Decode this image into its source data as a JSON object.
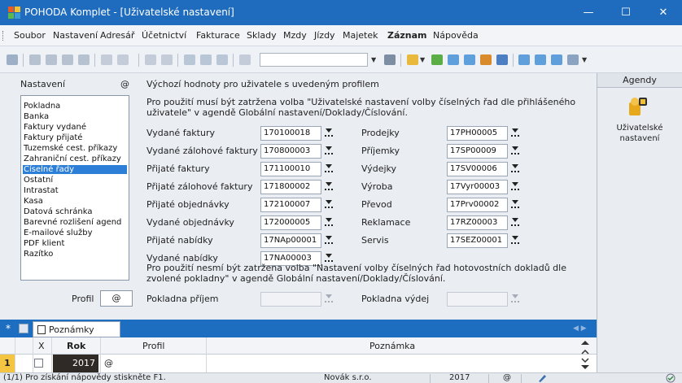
{
  "window": {
    "title": "POHODA Komplet - [Uživatelské nastavení]",
    "min_glyph": "—",
    "max_glyph": "☐",
    "close_glyph": "✕"
  },
  "menu": {
    "items": [
      "Soubor",
      "Nastavení",
      "Adresář",
      "Účetnictví",
      "Fakturace",
      "Sklady",
      "Mzdy",
      "Jízdy",
      "Majetek",
      "Záznam",
      "Nápověda"
    ]
  },
  "settings": {
    "nastaveni_label": "Nastavení",
    "at_symbol": "@",
    "header": "Výchozí hodnoty pro uživatele s uvedeným profilem",
    "list": [
      "Pokladna",
      "Banka",
      "Faktury vydané",
      "Faktury přijaté",
      "Tuzemské cest. příkazy",
      "Zahraniční cest. příkazy",
      "Číselné řady",
      "Ostatní",
      "Intrastat",
      "Kasa",
      "Datová schránka",
      "Barevné rozlišení agend",
      "E-mailové služby",
      "PDF klient",
      "Razítko"
    ],
    "selected_item": "Číselné řady",
    "note1_line1": "Pro použití musí být zatržena volba \"Uživatelské nastavení volby číselných řad dle přihlášeného",
    "note1_line2": "uživatele\" v agendě Globální nastavení/Doklady/Číslování.",
    "left_fields": [
      {
        "label": "Vydané faktury",
        "value": "170100018"
      },
      {
        "label": "Vydané zálohové faktury",
        "value": "170800003"
      },
      {
        "label": "Přijaté faktury",
        "value": "171100010"
      },
      {
        "label": "Přijaté zálohové faktury",
        "value": "171800002"
      },
      {
        "label": "Přijaté objednávky",
        "value": "172100007"
      },
      {
        "label": "Vydané objednávky",
        "value": "172000005"
      },
      {
        "label": "Přijaté nabídky",
        "value": "17NAp00001"
      },
      {
        "label": "Vydané nabídky",
        "value": "17NA00003"
      }
    ],
    "right_fields": [
      {
        "label": "Prodejky",
        "value": "17PH00005"
      },
      {
        "label": "Příjemky",
        "value": "17SP00009"
      },
      {
        "label": "Výdejky",
        "value": "17SV00006"
      },
      {
        "label": "Výroba",
        "value": "17Vyr00003"
      },
      {
        "label": "Převod",
        "value": "17Prv00002"
      },
      {
        "label": "Reklamace",
        "value": "17RZ00003"
      },
      {
        "label": "Servis",
        "value": "17SEZ00001"
      }
    ],
    "note2_line1": "Pro použití nesmí být zatržena volba \"Nastavení volby číselných řad hotovostních dokladů dle",
    "note2_line2": "zvolené pokladny\" v agendě Globální nastavení/Doklady/Číslování.",
    "profil_label": "Profil",
    "profil_value": "@",
    "pokladna_prijem_label": "Pokladna příjem",
    "pokladna_vydej_label": "Pokladna výdej"
  },
  "agendy": {
    "title": "Agendy",
    "item_label_line1": "Uživatelské",
    "item_label_line2": "nastavení"
  },
  "bottom": {
    "tab_star": "*",
    "tab_notes": "Poznámky",
    "columns": {
      "x": "X",
      "rok": "Rok",
      "profil": "Profil",
      "poznamka": "Poznámka"
    },
    "row": {
      "num": "1",
      "rok": "2017",
      "profil": "@"
    }
  },
  "status": {
    "help": "(1/1) Pro získání nápovědy stiskněte F1.",
    "company": "Novák s.r.o.",
    "year": "2017",
    "at": "@"
  },
  "colors": {
    "titlebar": "#1f6cbf",
    "selection": "#2c7ed6",
    "row_highlight": "#f4c542",
    "year_cell": "#2f2a26"
  }
}
